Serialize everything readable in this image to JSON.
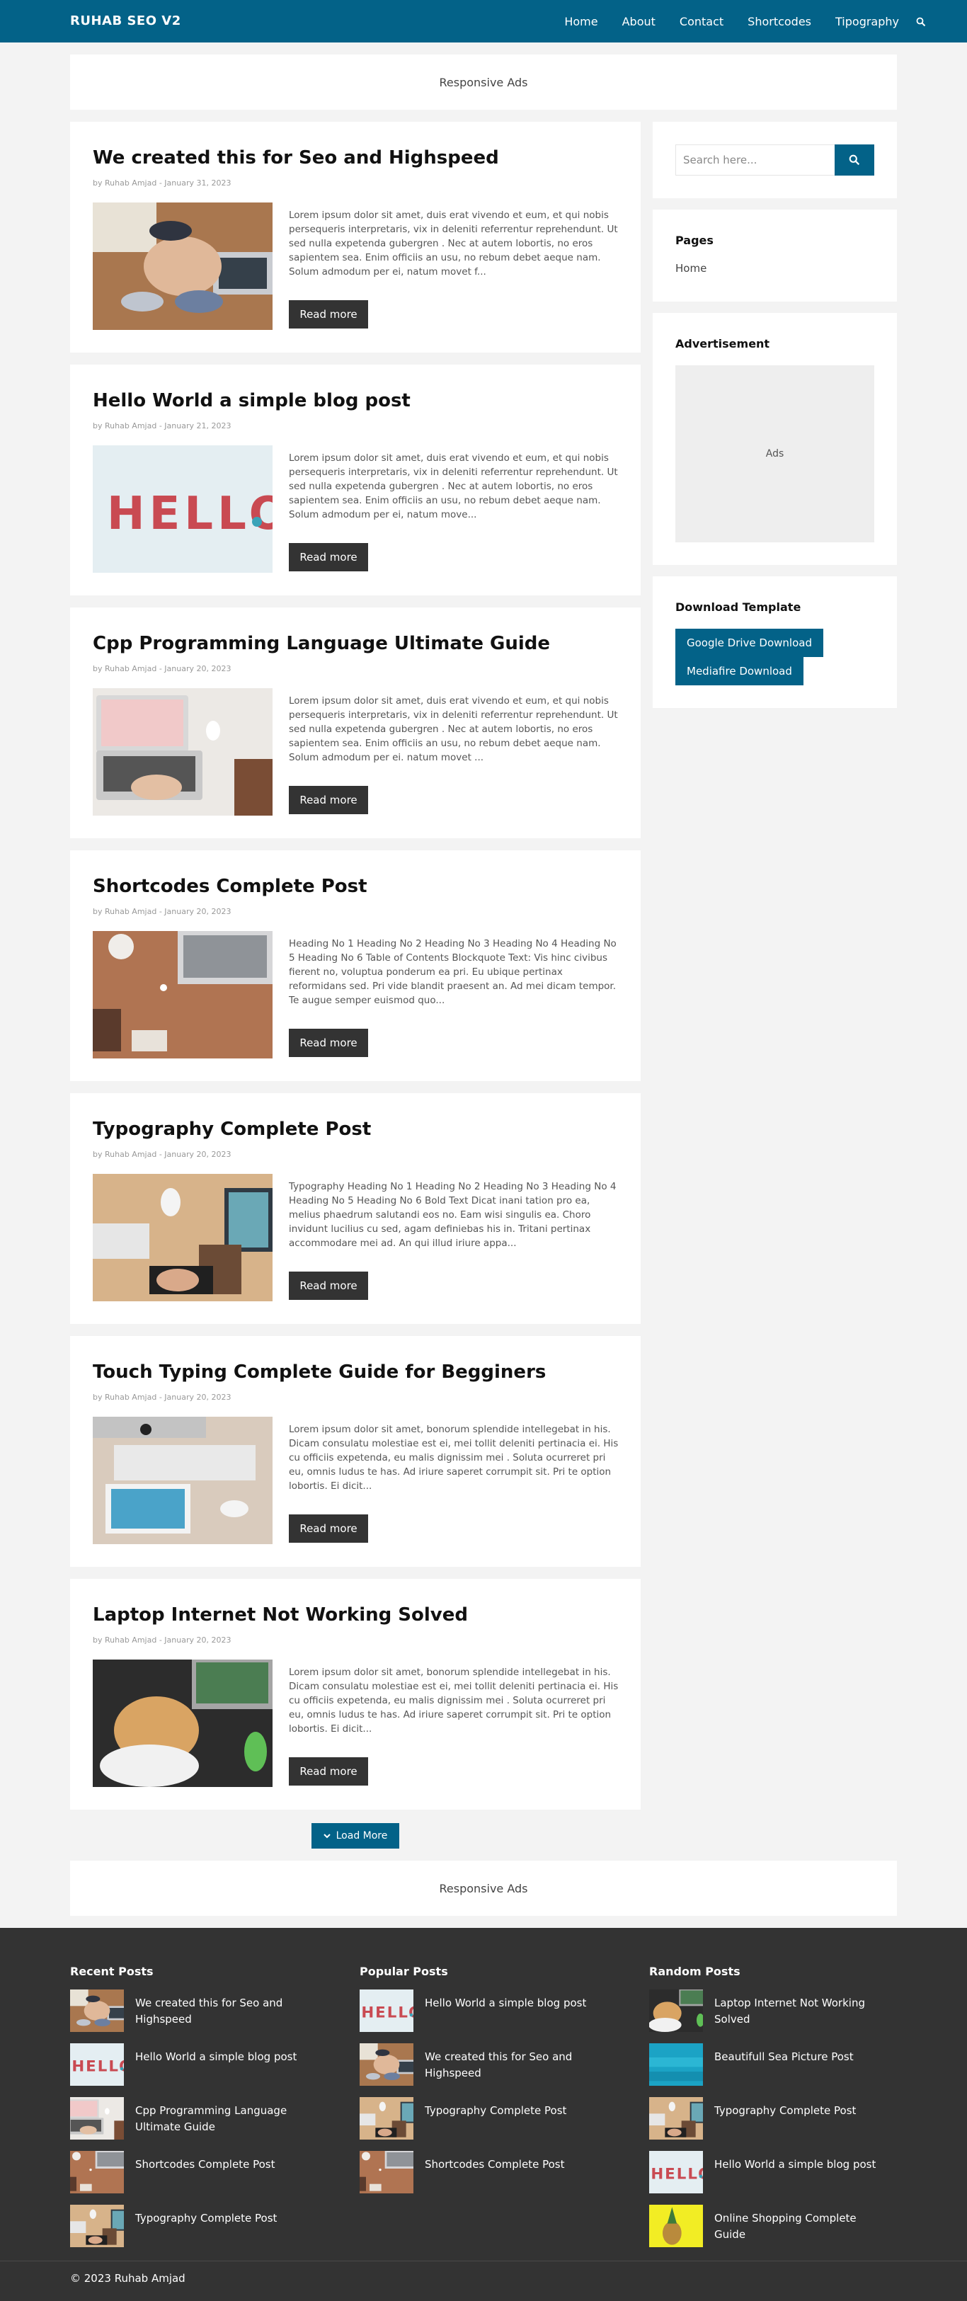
{
  "header": {
    "logo": "RUHAB SEO V2",
    "nav": [
      "Home",
      "About",
      "Contact",
      "Shortcodes",
      "Tipography"
    ]
  },
  "ads": {
    "top": "Responsive Ads",
    "bottom": "Responsive Ads"
  },
  "posts": [
    {
      "title": "We created this for Seo and Highspeed",
      "meta": "by Ruhab Amjad - January 31, 2023",
      "excerpt": "Lorem ipsum dolor sit amet, duis erat vivendo et eum, et qui nobis persequeris interpretaris, vix in deleniti referrentur reprehendunt. Ut sed nulla expetenda gubergren . Nec at autem lobortis, no eros sapientem sea. Enim officiis an usu, no rebum debet aeque nam. Solum admodum per ei, natum movet f...",
      "read_more": "Read more"
    },
    {
      "title": "Hello World a simple blog post",
      "meta": "by Ruhab Amjad - January 21, 2023",
      "excerpt": "Lorem ipsum dolor sit amet, duis erat vivendo et eum, et qui nobis persequeris interpretaris, vix in deleniti referrentur reprehendunt.  Ut sed nulla expetenda gubergren . Nec at autem lobortis, no eros sapientem sea. Enim officiis an usu, no rebum debet aeque nam. Solum admodum per ei, natum move...",
      "read_more": "Read more"
    },
    {
      "title": "Cpp Programming Language Ultimate Guide",
      "meta": "by Ruhab Amjad - January 20, 2023",
      "excerpt": "Lorem ipsum dolor sit amet, duis erat vivendo et eum, et qui nobis persequeris interpretaris, vix in deleniti referrentur reprehendunt. Ut sed nulla expetenda gubergren . Nec at autem lobortis, no eros sapientem sea. Enim officiis an usu, no rebum debet aeque nam. Solum admodum per ei. natum movet ...",
      "read_more": "Read more"
    },
    {
      "title": "Shortcodes Complete Post",
      "meta": "by Ruhab Amjad - January 20, 2023",
      "excerpt": "Heading No 1 Heading No 2 Heading No 3 Heading No 4 Heading No 5 Heading No 6 Table of Contents Blockquote Text: Vis hinc civibus fierent no, voluptua ponderum ea pri. Eu ubique pertinax reformidans sed. Pri vide blandit praesent an. Ad mei dicam tempor. Te augue semper euismod quo...",
      "read_more": "Read more"
    },
    {
      "title": "Typography Complete Post",
      "meta": "by Ruhab Amjad - January 20, 2023",
      "excerpt": "Typography Heading No 1 Heading No 2 Heading No 3 Heading No 4 Heading No 5 Heading No 6 Bold Text Dicat inani tation pro ea, melius phaedrum salutandi eos no. Eam wisi singulis ea. Choro invidunt lucilius cu sed, agam definiebas his in. Tritani pertinax accommodare mei ad. An qui illud iriure appa...",
      "read_more": "Read more"
    },
    {
      "title": "Touch Typing Complete Guide for Begginers",
      "meta": "by Ruhab Amjad - January 20, 2023",
      "excerpt": "Lorem ipsum dolor sit amet, bonorum splendide intellegebat in his. Dicam consulatu molestiae est ei, mei tollit deleniti pertinacia ei.  His cu officiis expetenda, eu malis dignissim mei . Soluta ocurreret pri eu, omnis ludus te has. Ad iriure saperet corrumpit sit. Pri te option lobortis. Ei dicit...",
      "read_more": "Read more"
    },
    {
      "title": "Laptop Internet Not Working Solved",
      "meta": "by Ruhab Amjad - January 20, 2023",
      "excerpt": "Lorem ipsum dolor sit amet, bonorum splendide intellegebat in his. Dicam consulatu molestiae est ei, mei tollit deleniti pertinacia ei.  His cu officiis expetenda, eu malis dignissim mei . Soluta ocurreret pri eu, omnis ludus te has. Ad iriure saperet corrumpit sit. Pri te option lobortis. Ei dicit...",
      "read_more": "Read more"
    }
  ],
  "sidebar": {
    "search_placeholder": "Search here...",
    "pages_heading": "Pages",
    "pages_link": "Home",
    "ad_heading": "Advertisement",
    "ad_text": "Ads",
    "download_heading": "Download Template",
    "download_buttons": [
      "Google Drive Download",
      "Mediafire Download"
    ]
  },
  "load_more": "Load More",
  "footer": {
    "columns": [
      {
        "heading": "Recent Posts",
        "items": [
          "We created this for Seo and Highspeed",
          "Hello World a simple blog post",
          "Cpp Programming Language Ultimate Guide",
          "Shortcodes Complete Post",
          "Typography Complete Post"
        ]
      },
      {
        "heading": "Popular Posts",
        "items": [
          "Hello World a simple blog post",
          "We created this for Seo and Highspeed",
          "Typography Complete Post",
          "Shortcodes Complete Post"
        ]
      },
      {
        "heading": "Random Posts",
        "items": [
          "Laptop Internet Not Working Solved",
          "Beautifull Sea Picture Post",
          "Typography Complete Post",
          "Hello World a simple blog post",
          "Online Shopping Complete Guide"
        ]
      }
    ],
    "copyright": "© 2023 Ruhab Amjad"
  },
  "colors": {
    "primary": "#036288",
    "dark": "#333333",
    "background": "#f3f3f3"
  }
}
